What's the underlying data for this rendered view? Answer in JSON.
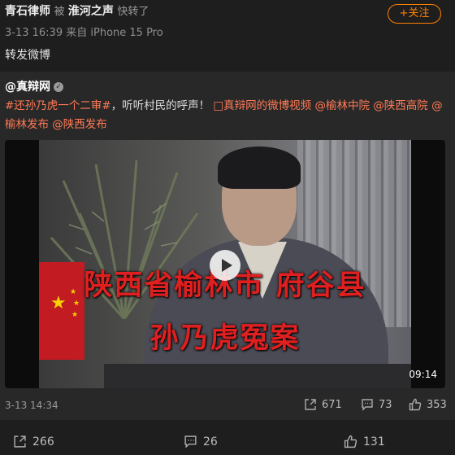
{
  "header": {
    "author": "青石律师",
    "by_word": "被",
    "source": "淮河之声",
    "reposted_text": "快转了",
    "time": "3-13 16:39",
    "device": "来自 iPhone 15 Pro",
    "follow_label": "+关注"
  },
  "repost_text": "转发微博",
  "original": {
    "author": "@真辩网",
    "hashtag": "#还孙乃虎一个二审#",
    "text": "，听听村民的呼声！",
    "video_link": "□真辩网的微博视频",
    "mentions": [
      "@榆林中院",
      "@陕西高院",
      "@榆林发布",
      "@陕西发布"
    ],
    "video": {
      "caption_line1": "陕西省榆林市  府谷县",
      "caption_line2": "孙乃虎冤案",
      "duration": "09:14"
    },
    "time": "3-13 14:34",
    "stats": {
      "reposts": "671",
      "comments": "73",
      "likes": "353"
    }
  },
  "actions": {
    "reposts": "266",
    "comments": "26",
    "likes": "131"
  },
  "colors": {
    "accent": "#ff8200",
    "link": "#ff7a56",
    "background": "#1e1e1e"
  }
}
